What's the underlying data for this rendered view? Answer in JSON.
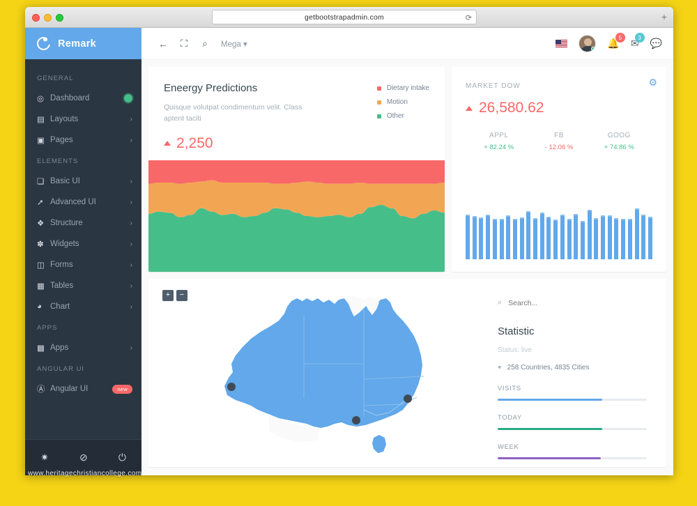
{
  "browser": {
    "url": "getbootstrapadmin.com",
    "reload_icon": "reload-icon",
    "newtab_label": "+"
  },
  "sidebar": {
    "brand": "Remark",
    "sections": [
      {
        "title": "GENERAL",
        "items": [
          {
            "label": "Dashboard",
            "icon": "dashboard-icon",
            "glyph": "◎",
            "trailing": "dot"
          },
          {
            "label": "Layouts",
            "icon": "layouts-icon",
            "glyph": "▤",
            "trailing": "chevron"
          },
          {
            "label": "Pages",
            "icon": "pages-icon",
            "glyph": "▣",
            "trailing": "chevron"
          }
        ]
      },
      {
        "title": "ELEMENTS",
        "items": [
          {
            "label": "Basic UI",
            "icon": "bookmark-icon",
            "glyph": "❏",
            "trailing": "chevron"
          },
          {
            "label": "Advanced UI",
            "icon": "rocket-icon",
            "glyph": "➚",
            "trailing": "chevron"
          },
          {
            "label": "Structure",
            "icon": "structure-icon",
            "glyph": "❖",
            "trailing": "chevron"
          },
          {
            "label": "Widgets",
            "icon": "puzzle-icon",
            "glyph": "✽",
            "trailing": "chevron"
          },
          {
            "label": "Forms",
            "icon": "forms-icon",
            "glyph": "◫",
            "trailing": "chevron"
          },
          {
            "label": "Tables",
            "icon": "tables-icon",
            "glyph": "▦",
            "trailing": "chevron"
          },
          {
            "label": "Chart",
            "icon": "pie-chart-icon",
            "glyph": "◕",
            "trailing": "chevron"
          }
        ]
      },
      {
        "title": "APPS",
        "items": [
          {
            "label": "Apps",
            "icon": "grid-icon",
            "glyph": "▩",
            "trailing": "chevron"
          }
        ]
      },
      {
        "title": "ANGULAR UI",
        "items": [
          {
            "label": "Angular UI",
            "icon": "angular-icon",
            "glyph": "Ⓐ",
            "trailing": "pill",
            "pill_label": "new"
          }
        ]
      }
    ],
    "footer": [
      {
        "name": "settings-icon",
        "glyph": "✷"
      },
      {
        "name": "theme-icon",
        "glyph": "⊘"
      },
      {
        "name": "power-icon",
        "glyph": "⏻"
      }
    ],
    "chevron_glyph": "›"
  },
  "topbar": {
    "back_icon": "back-arrow-icon",
    "back_glyph": "←",
    "fullscreen_icon": "fullscreen-icon",
    "fullscreen_glyph": "⛶",
    "search_icon": "search-icon",
    "search_glyph": "⌕",
    "mega_label": "Mega",
    "mega_caret": "▾",
    "flag_name": "us-flag-icon",
    "avatar_name": "user-avatar",
    "notifications": {
      "icon": "bell-icon",
      "glyph": "🔔",
      "count": "5",
      "color": "#f96868"
    },
    "messages": {
      "icon": "envelope-icon",
      "glyph": "✉",
      "count": "3",
      "color": "#57c7d4"
    },
    "chat": {
      "icon": "chat-icon",
      "glyph": "💬"
    }
  },
  "energy": {
    "title": "Eneergy Predictions",
    "description": "Quisque volutpat condimentum velit. Class aptent taciti",
    "value": "2,250",
    "trend": "up",
    "legend": [
      {
        "label": "Dietary intake",
        "color": "#f96868"
      },
      {
        "label": "Motion",
        "color": "#f2a654"
      },
      {
        "label": "Other",
        "color": "#46be8a"
      }
    ]
  },
  "market": {
    "label": "MARKET DOW",
    "value": "26,580.62",
    "trend": "up",
    "stocks": [
      {
        "symbol": "APPL",
        "change": "+ 82.24 %",
        "direction": "up"
      },
      {
        "symbol": "FB",
        "change": "- 12.06 %",
        "direction": "down"
      },
      {
        "symbol": "GOOG",
        "change": "+ 74.86 %",
        "direction": "up"
      }
    ],
    "gear_icon": "gear-icon"
  },
  "map": {
    "zoom_in_label": "+",
    "zoom_out_label": "−",
    "region": "Australia",
    "markers": 3
  },
  "statistic": {
    "search_placeholder": "Search...",
    "title": "Statistic",
    "status": "Status: live",
    "location": "258 Countries, 4835 Cities",
    "location_icon": "map-pin-icon",
    "progress": [
      {
        "label": "VISITS",
        "percent": 70,
        "color": "#62a8ea"
      },
      {
        "label": "TODAY",
        "percent": 70,
        "color": "#2aab84"
      },
      {
        "label": "WEEK",
        "percent": 69,
        "color": "#8e62c4"
      }
    ]
  },
  "watermark": "www.heritagechristiancollege.com",
  "chart_data": [
    {
      "type": "area",
      "title": "Eneergy Predictions",
      "stacked": true,
      "xlabel": "",
      "ylabel": "",
      "grid": false,
      "legend_position": "top-right",
      "series": [
        {
          "name": "Other",
          "color": "#46be8a",
          "values": [
            52,
            54,
            53,
            49,
            51,
            57,
            54,
            51,
            52,
            49,
            50,
            53,
            57,
            56,
            53,
            50,
            49,
            50,
            51,
            49,
            52,
            58,
            60,
            57,
            50,
            48,
            52,
            55,
            53
          ]
        },
        {
          "name": "Motion",
          "color": "#f2a654",
          "values": [
            27,
            26,
            27,
            30,
            29,
            24,
            28,
            29,
            28,
            31,
            30,
            27,
            22,
            23,
            27,
            31,
            31,
            29,
            28,
            30,
            28,
            21,
            19,
            22,
            29,
            31,
            27,
            24,
            27
          ]
        },
        {
          "name": "Dietary intake",
          "color": "#f96868",
          "values": [
            21,
            20,
            20,
            21,
            20,
            19,
            18,
            20,
            20,
            20,
            20,
            20,
            21,
            21,
            20,
            19,
            20,
            21,
            21,
            21,
            20,
            21,
            21,
            21,
            21,
            21,
            21,
            21,
            20
          ]
        }
      ]
    },
    {
      "type": "bar",
      "title": "MARKET DOW",
      "color": "#62a8ea",
      "xlabel": "",
      "ylabel": "",
      "grid": false,
      "categories": [
        "1",
        "2",
        "3",
        "4",
        "5",
        "6",
        "7",
        "8",
        "9",
        "10",
        "11",
        "12",
        "13",
        "14",
        "15",
        "16",
        "17",
        "18",
        "19",
        "20",
        "21",
        "22",
        "23",
        "24",
        "25",
        "26",
        "27",
        "28"
      ],
      "values": [
        74,
        72,
        70,
        74,
        67,
        67,
        73,
        68,
        70,
        80,
        69,
        78,
        71,
        66,
        74,
        68,
        76,
        64,
        82,
        69,
        73,
        73,
        69,
        68,
        67,
        85,
        74,
        71
      ],
      "ylim": [
        0,
        100
      ]
    },
    {
      "type": "bar",
      "title": "Statistic progress",
      "orientation": "horizontal",
      "categories": [
        "VISITS",
        "TODAY",
        "WEEK"
      ],
      "values": [
        70,
        70,
        69
      ],
      "ylim": [
        0,
        100
      ],
      "colors": [
        "#62a8ea",
        "#2aab84",
        "#8e62c4"
      ]
    }
  ]
}
